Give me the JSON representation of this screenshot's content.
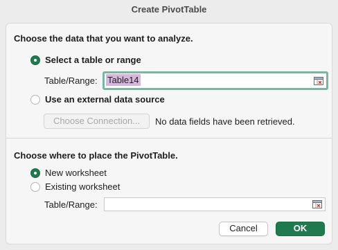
{
  "window": {
    "title": "Create PivotTable"
  },
  "source_section": {
    "heading": "Choose the data that you want to analyze.",
    "option_table": {
      "label": "Select a table or range",
      "selected": true
    },
    "range_label": "Table/Range:",
    "range_value": "Table14",
    "option_external": {
      "label": "Use an external data source",
      "selected": false
    },
    "choose_connection_label": "Choose Connection...",
    "connection_note": "No data fields have been retrieved."
  },
  "placement_section": {
    "heading": "Choose where to place the PivotTable.",
    "option_new": {
      "label": "New worksheet",
      "selected": true
    },
    "option_existing": {
      "label": "Existing worksheet",
      "selected": false
    },
    "range_label": "Table/Range:",
    "range_value": ""
  },
  "buttons": {
    "cancel_label": "Cancel",
    "ok_label": "OK"
  },
  "icons": {
    "range_picker": "range-picker-icon",
    "radio_selected": "radio-selected",
    "radio_unselected": "radio-unselected"
  },
  "colors": {
    "accent": "#1f7a4f",
    "focus_ring": "#7ab5a3",
    "selection_highlight": "#d7b6dd"
  }
}
